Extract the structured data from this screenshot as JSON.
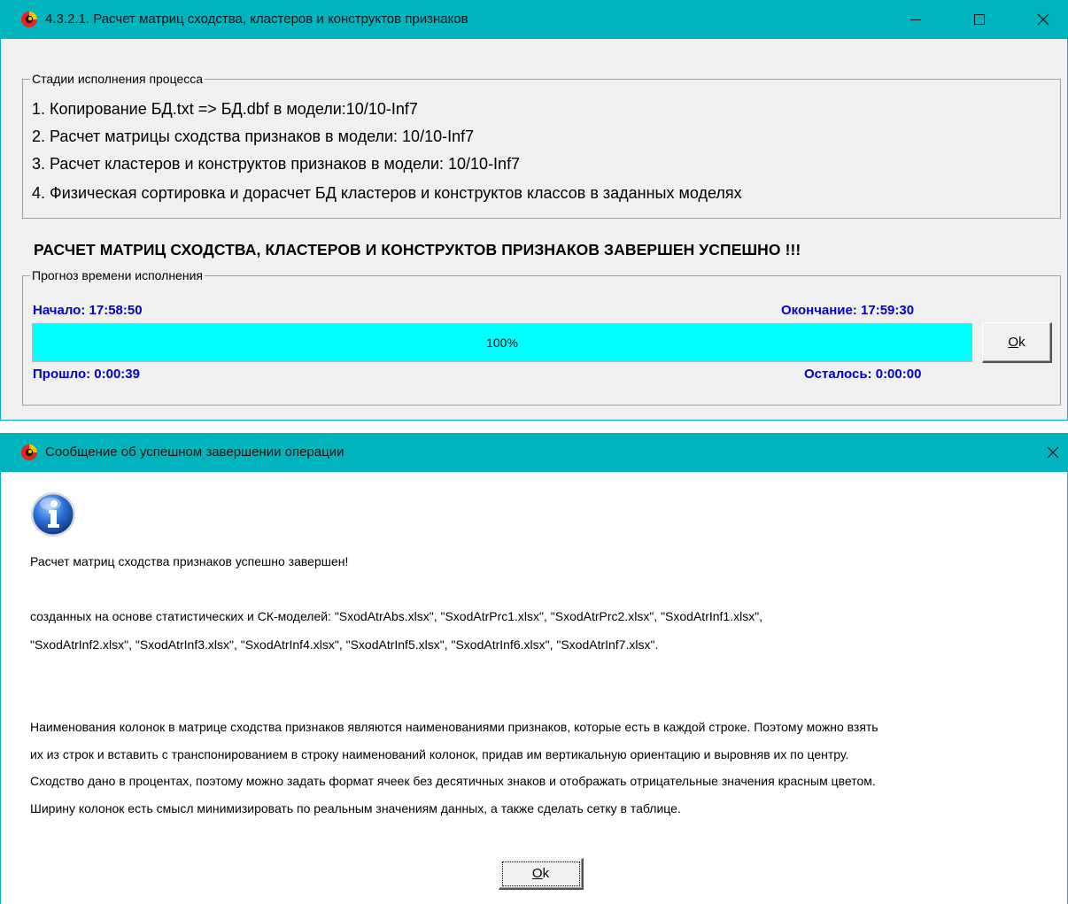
{
  "window1": {
    "title": "4.3.2.1. Расчет матриц сходства, кластеров и конструктов признаков",
    "stages_group_label": "Стадии исполнения процесса",
    "stages": [
      "1. Копирование БД.txt => БД.dbf в модели:10/10-Inf7",
      "2. Расчет матрицы сходства признаков в модели: 10/10-Inf7",
      "3. Расчет кластеров и конструктов признаков в модели: 10/10-Inf7",
      "4. Физическая сортировка и дорасчет БД кластеров и конструктов классов в заданных моделях"
    ],
    "completion_message": "РАСЧЕТ МАТРИЦ СХОДСТВА, КЛАСТЕРОВ И КОНСТРУКТОВ ПРИЗНАКОВ ЗАВЕРШЕН УСПЕШНО !!!",
    "time_group_label": "Прогноз времени исполнения",
    "start": "Начало: 17:58:50",
    "end": "Окончание: 17:59:30",
    "elapsed": "Прошло: 0:00:39",
    "remaining": "Осталось: 0:00:00",
    "progress_percent": 100,
    "progress_text": "100%",
    "ok_label_first": "O",
    "ok_label_rest": "k",
    "minimize_icon": "minimize-icon",
    "maximize_icon": "maximize-icon",
    "close_icon": "close-icon"
  },
  "window2": {
    "title": "Сообщение об успешном завершении операции",
    "icon": "info-icon",
    "line1": "Расчет матриц сходства признаков успешно завершен!",
    "line2": "созданных на основе статистических и СК-моделей: \"SxodAtrAbs.xlsx\", \"SxodAtrPrc1.xlsx\", \"SxodAtrPrc2.xlsx\", \"SxodAtrInf1.xlsx\",",
    "line3": "\"SxodAtrInf2.xlsx\", \"SxodAtrInf3.xlsx\", \"SxodAtrInf4.xlsx\", \"SxodAtrInf5.xlsx\", \"SxodAtrInf6.xlsx\", \"SxodAtrInf7.xlsx\".",
    "para": [
      "Наименования колонок в матрице сходства признаков являются наименованиями признаков, которые есть в каждой строке. Поэтому можно взять",
      "их из строк и вставить с транспонированием в строку наименований колонок, придав им вертикальную ориентацию и выровняв их по центру.",
      "Сходство дано в процентах, поэтому можно задать формат ячеек без десятичных знаков и отображать отрицательные значения красным цветом.",
      "Ширину колонок есть смысл минимизировать по реальным значениям данных, а также сделать сетку в таблице."
    ],
    "ok_label_first": "O",
    "ok_label_rest": "k"
  },
  "colors": {
    "titlebar": "#00b4be",
    "progress_fill": "#00ffff",
    "time_labels": "#0000d0"
  }
}
